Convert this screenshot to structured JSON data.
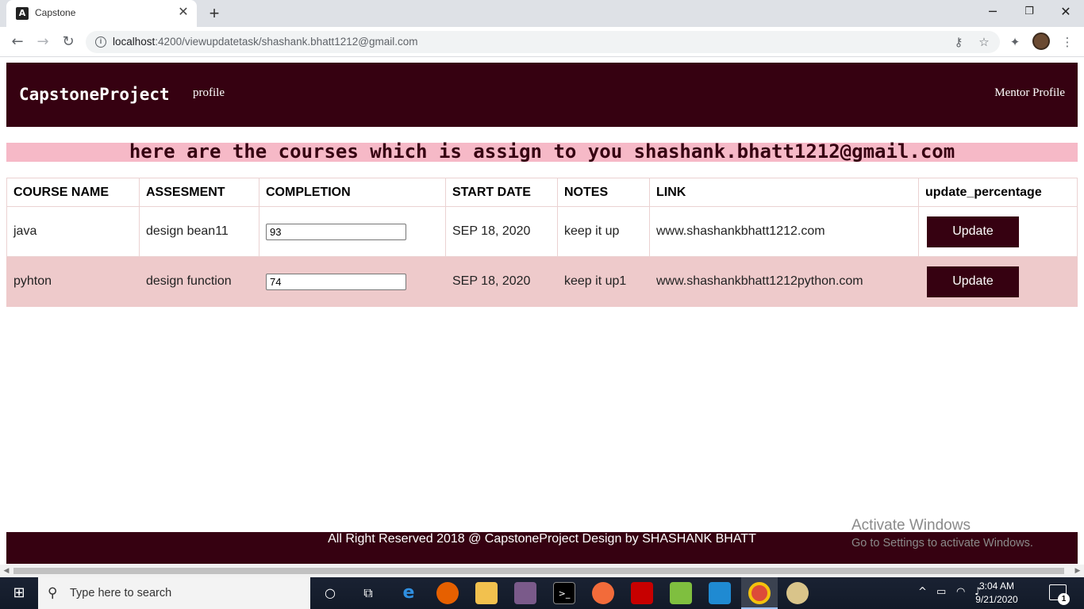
{
  "browser": {
    "tab_title": "Capstone",
    "tab_favicon": "A",
    "url_host": "localhost",
    "url_path": ":4200/viewupdatetask/shashank.bhatt1212@gmail.com"
  },
  "navbar": {
    "brand": "CapstoneProject",
    "profile_link": "profile",
    "mentor_link": "Mentor Profile"
  },
  "banner": {
    "text": "here are the courses which is assign to you shashank.bhatt1212@gmail.com"
  },
  "table": {
    "headers": [
      "COURSE NAME",
      "ASSESMENT",
      "COMPLETION",
      "START DATE",
      "NOTES",
      "LINK",
      "update_percentage"
    ],
    "rows": [
      {
        "course": "java",
        "assessment": "design bean11",
        "completion": "93",
        "start_date": "SEP 18, 2020",
        "notes": "keep it up",
        "link": "www.shashankbhatt1212.com",
        "button": "Update"
      },
      {
        "course": "pyhton",
        "assessment": "design function",
        "completion": "74",
        "start_date": "SEP 18, 2020",
        "notes": "keep it up1",
        "link": "www.shashankbhatt1212python.com",
        "button": "Update"
      }
    ]
  },
  "footer": {
    "text": "All Right Reserved 2018 @ CapstoneProject Design by SHASHANK BHATT"
  },
  "watermark": {
    "line1": "Activate Windows",
    "line2": "Go to Settings to activate Windows."
  },
  "taskbar": {
    "search_placeholder": "Type here to search",
    "time": "3:04 AM",
    "date": "9/21/2020",
    "notification_count": "1"
  },
  "colors": {
    "brand_dark": "#360111",
    "banner_pink": "#f6b9c7",
    "row_alt": "#eecacb"
  }
}
